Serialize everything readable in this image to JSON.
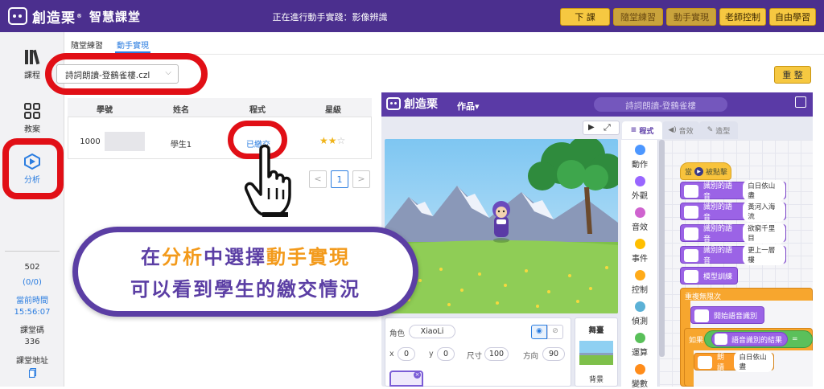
{
  "header": {
    "brand": "創造栗",
    "brand_mark": "®",
    "subtitle": "智慧課堂",
    "status": "正在進行動手實踐：影像辨識",
    "buttons": [
      "下 課",
      "隨堂練習",
      "動手實現",
      "老師控制",
      "自由學習"
    ]
  },
  "sidebar": {
    "items": [
      {
        "label": "課程",
        "icon": "books-icon"
      },
      {
        "label": "教案",
        "icon": "grid-icon"
      },
      {
        "label": "分析",
        "icon": "analysis-icon",
        "active": true
      }
    ],
    "stats": {
      "count": "502",
      "ratio": "(0/0)",
      "time_label": "當前時間",
      "time_value": "15:56:07",
      "code_label": "課堂碼",
      "code_value": "336",
      "address_label": "課堂地址"
    }
  },
  "subtabs": {
    "items": [
      "隨堂練習",
      "動手實現"
    ],
    "active": "動手實現"
  },
  "file_select": {
    "value": "詩詞朗讀-登鶴雀樓.czl"
  },
  "reset_button": "重 整",
  "table": {
    "headers": [
      "學號",
      "姓名",
      "程式",
      "星級"
    ],
    "rows": [
      {
        "id": "1000",
        "name": "學生1",
        "status": "已繳交",
        "stars": 2,
        "max_stars": 3
      }
    ]
  },
  "pagination": {
    "prev": "<",
    "current": "1",
    "next": ">"
  },
  "editor": {
    "brand": "創造栗",
    "menu": "作品",
    "project_name": "詩詞朗讀-登鶴雀樓",
    "tabs": [
      "程式",
      "音效",
      "造型"
    ],
    "categories": [
      {
        "label": "動作",
        "color": "#4c97ff"
      },
      {
        "label": "外觀",
        "color": "#9966ff"
      },
      {
        "label": "音效",
        "color": "#cf63cf"
      },
      {
        "label": "事件",
        "color": "#ffbf00"
      },
      {
        "label": "控制",
        "color": "#ffab19"
      },
      {
        "label": "偵測",
        "color": "#5cb1d6"
      },
      {
        "label": "運算",
        "color": "#59c059"
      },
      {
        "label": "變數",
        "color": "#ff8c1a"
      }
    ],
    "blocks": {
      "hat": "當",
      "hat_suffix": "被點擊",
      "speech_label": "識別的語音",
      "speech_values": [
        "白日依山盡",
        "黃河入海流",
        "欲窮千里目",
        "更上一層樓"
      ],
      "train": "模型訓練",
      "forever": "重複無限次",
      "start_recog": "開始語音識別",
      "if": "如果",
      "recog_result": "語音識別的結果",
      "equals": "=",
      "read": "朗讀",
      "read_value": "白日依山盡"
    },
    "sprite": {
      "role_label": "角色",
      "name": "XiaoLi",
      "x_label": "x",
      "x": "0",
      "y_label": "y",
      "y": "0",
      "size_label": "尺寸",
      "size": "100",
      "dir_label": "方向",
      "dir": "90"
    },
    "stage_panel": {
      "title": "舞臺",
      "label": "背景"
    }
  },
  "callout": {
    "line1_pre": "在",
    "line1_hl1": "分析",
    "line1_mid": "中選擇",
    "line1_hl2": "動手實現",
    "line2": "可以看到學生的繳交情況"
  },
  "colors": {
    "header_bg": "#4b2f8e",
    "accent_blue": "#2b7de0",
    "highlight_red": "#e10f16",
    "button_yellow": "#f6c841",
    "callout_purple": "#5b3ea4",
    "callout_orange": "#f39a1b"
  }
}
